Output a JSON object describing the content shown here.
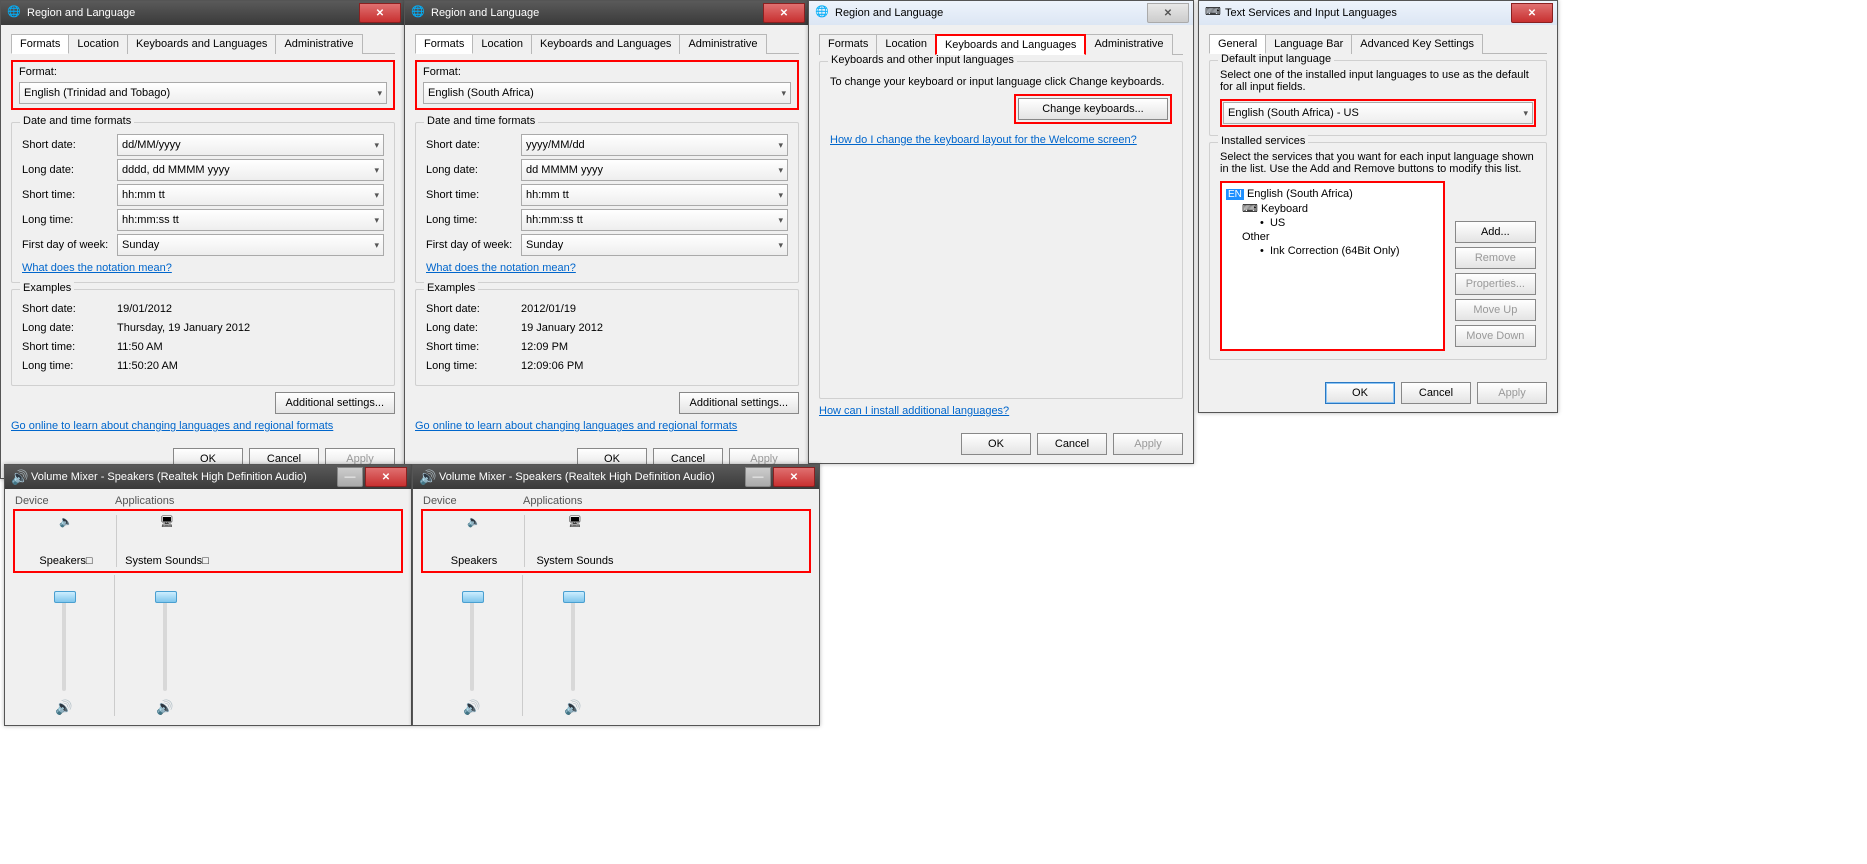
{
  "w1": {
    "title": "Region and Language",
    "tabs": [
      "Formats",
      "Location",
      "Keyboards and Languages",
      "Administrative"
    ],
    "format_label": "Format:",
    "format_value": "English (Trinidad and Tobago)",
    "dt_group": "Date and time formats",
    "rows": {
      "short_date_l": "Short date:",
      "short_date_v": "dd/MM/yyyy",
      "long_date_l": "Long date:",
      "long_date_v": "dddd, dd MMMM yyyy",
      "short_time_l": "Short time:",
      "short_time_v": "hh:mm tt",
      "long_time_l": "Long time:",
      "long_time_v": "hh:mm:ss tt",
      "fdow_l": "First day of week:",
      "fdow_v": "Sunday"
    },
    "notation_link": "What does the notation mean?",
    "examples": "Examples",
    "ex": {
      "sd_l": "Short date:",
      "sd_v": "19/01/2012",
      "ld_l": "Long date:",
      "ld_v": "Thursday, 19 January 2012",
      "st_l": "Short time:",
      "st_v": "11:50 AM",
      "lt_l": "Long time:",
      "lt_v": "11:50:20 AM"
    },
    "additional": "Additional settings...",
    "golink": "Go online to learn about changing languages and regional formats",
    "ok": "OK",
    "cancel": "Cancel",
    "apply": "Apply"
  },
  "w2": {
    "title": "Region and Language",
    "tabs": [
      "Formats",
      "Location",
      "Keyboards and Languages",
      "Administrative"
    ],
    "format_label": "Format:",
    "format_value": "English (South Africa)",
    "dt_group": "Date and time formats",
    "rows": {
      "short_date_l": "Short date:",
      "short_date_v": "yyyy/MM/dd",
      "long_date_l": "Long date:",
      "long_date_v": "dd MMMM yyyy",
      "short_time_l": "Short time:",
      "short_time_v": "hh:mm tt",
      "long_time_l": "Long time:",
      "long_time_v": "hh:mm:ss tt",
      "fdow_l": "First day of week:",
      "fdow_v": "Sunday"
    },
    "notation_link": "What does the notation mean?",
    "examples": "Examples",
    "ex": {
      "sd_l": "Short date:",
      "sd_v": "2012/01/19",
      "ld_l": "Long date:",
      "ld_v": "19 January 2012",
      "st_l": "Short time:",
      "st_v": "12:09 PM",
      "lt_l": "Long time:",
      "lt_v": "12:09:06 PM"
    },
    "additional": "Additional settings...",
    "golink": "Go online to learn about changing languages and regional formats",
    "ok": "OK",
    "cancel": "Cancel",
    "apply": "Apply"
  },
  "w3": {
    "title": "Region and Language",
    "tabs": [
      "Formats",
      "Location",
      "Keyboards and Languages",
      "Administrative"
    ],
    "kb_heading": "Keyboards and other input languages",
    "kb_text": "To change your keyboard or input language click Change keyboards.",
    "change_kb": "Change keyboards...",
    "welcome_link": "How do I change the keyboard layout for the Welcome screen?",
    "addl_link": "How can I install additional languages?",
    "ok": "OK",
    "cancel": "Cancel",
    "apply": "Apply"
  },
  "w4": {
    "title": "Text Services and Input Languages",
    "tabs": [
      "General",
      "Language Bar",
      "Advanced Key Settings"
    ],
    "def_group": "Default input language",
    "def_text": "Select one of the installed input languages to use as the default for all input fields.",
    "def_val": "English (South Africa) - US",
    "inst_group": "Installed services",
    "inst_text": "Select the services that you want for each input language shown in the list. Use the Add and Remove buttons to modify this list.",
    "tree": {
      "lang": "English (South Africa)",
      "kb": "Keyboard",
      "us": "US",
      "other": "Other",
      "ink": "Ink Correction (64Bit Only)"
    },
    "btns": {
      "add": "Add...",
      "remove": "Remove",
      "props": "Properties...",
      "up": "Move Up",
      "down": "Move Down"
    },
    "ok": "OK",
    "cancel": "Cancel",
    "apply": "Apply"
  },
  "v1": {
    "title": "Volume Mixer - Speakers (Realtek High Definition Audio)",
    "device": "Device",
    "apps": "Applications",
    "speakers": "Speakers",
    "sys": "System Sounds",
    "tofu": "□"
  },
  "v2": {
    "title": "Volume Mixer - Speakers (Realtek High Definition Audio)",
    "device": "Device",
    "apps": "Applications",
    "speakers": "Speakers",
    "sys": "System Sounds"
  }
}
